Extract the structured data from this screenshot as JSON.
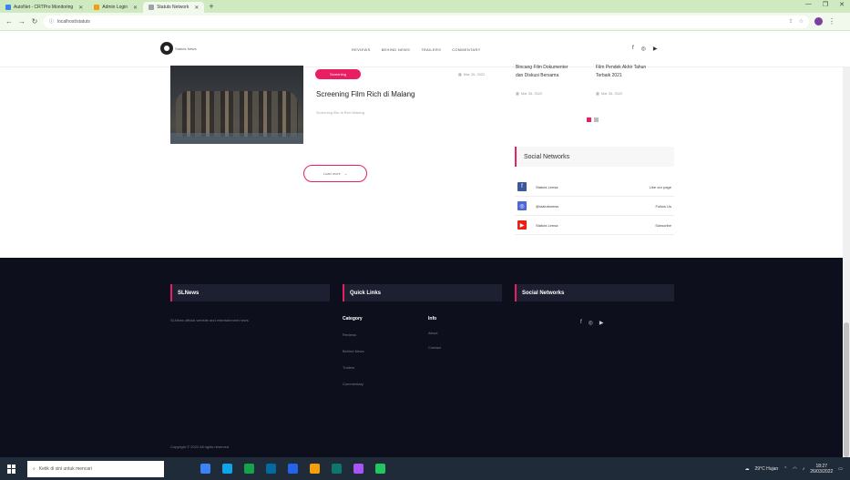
{
  "browser": {
    "tabs": [
      {
        "title": "AutoNet - CRTPro Monitoring",
        "color": "#3b82f6"
      },
      {
        "title": "Admin Login",
        "color": "#f59e0b"
      },
      {
        "title": "Statuts Network",
        "color": "#9ca3af",
        "active": true
      }
    ],
    "new_tab_icon": "plus-icon",
    "url": "localhost/statuts",
    "window_controls": [
      "—",
      "❐",
      "✕"
    ]
  },
  "site": {
    "logo_text": "Statuts News",
    "nav": [
      "REVIEWS",
      "BEHIND NEWS",
      "TRAILERS",
      "COMMENTARY"
    ],
    "header_social": [
      "f",
      "◎",
      "▶"
    ]
  },
  "article": {
    "category": "Screening",
    "date": "Mar 26, 2022",
    "title": "Screening Film Rich di Malang",
    "excerpt": "Screening film di Rich Malang",
    "load_more": "Load more"
  },
  "sidebar": {
    "recent": [
      {
        "title": "Bincang Film Dokumenter dan Diskusi Bersama",
        "date": "Mar 26, 2022"
      },
      {
        "title": "Film Pendek Akhir Tahun Terbaik 2021",
        "date": "Mar 26, 2022"
      }
    ],
    "social_title": "Social Networks",
    "social": [
      {
        "icon": "facebook-icon",
        "glyph": "f",
        "color": "#3b5998",
        "name": "Statuts Lensa",
        "action": "Like our page"
      },
      {
        "icon": "instagram-icon",
        "glyph": "◎",
        "color": "#4c68d7",
        "name": "@statutsnews",
        "action": "Follow Us"
      },
      {
        "icon": "youtube-icon",
        "glyph": "▶",
        "color": "#e62117",
        "name": "Statuts Lensa",
        "action": "Subscribe"
      }
    ]
  },
  "footer": {
    "about_title": "SLNews",
    "about_text": "SLNews official website and entertainment news",
    "links_title": "Quick Links",
    "category_title": "Category",
    "category_links": [
      "Reviews",
      "Behind News",
      "Trailers",
      "Commentary"
    ],
    "info_title": "Info",
    "info_links": [
      "About",
      "Contact"
    ],
    "social_title": "Social Networks",
    "social_icons": [
      "f",
      "◎",
      "▶"
    ],
    "copyright": "Copyright © 2022 All rights reserved"
  },
  "taskbar": {
    "search_placeholder": "Ketik di sini untuk mencari",
    "apps": [
      "#3b82f6",
      "#0ea5e9",
      "#16a34a",
      "#0369a1",
      "#2563eb",
      "#f59e0b",
      "#0f766e",
      "#a855f7",
      "#22c55e"
    ],
    "weather": "29°C Hujan",
    "time": "18:27",
    "date": "26/03/2022"
  }
}
